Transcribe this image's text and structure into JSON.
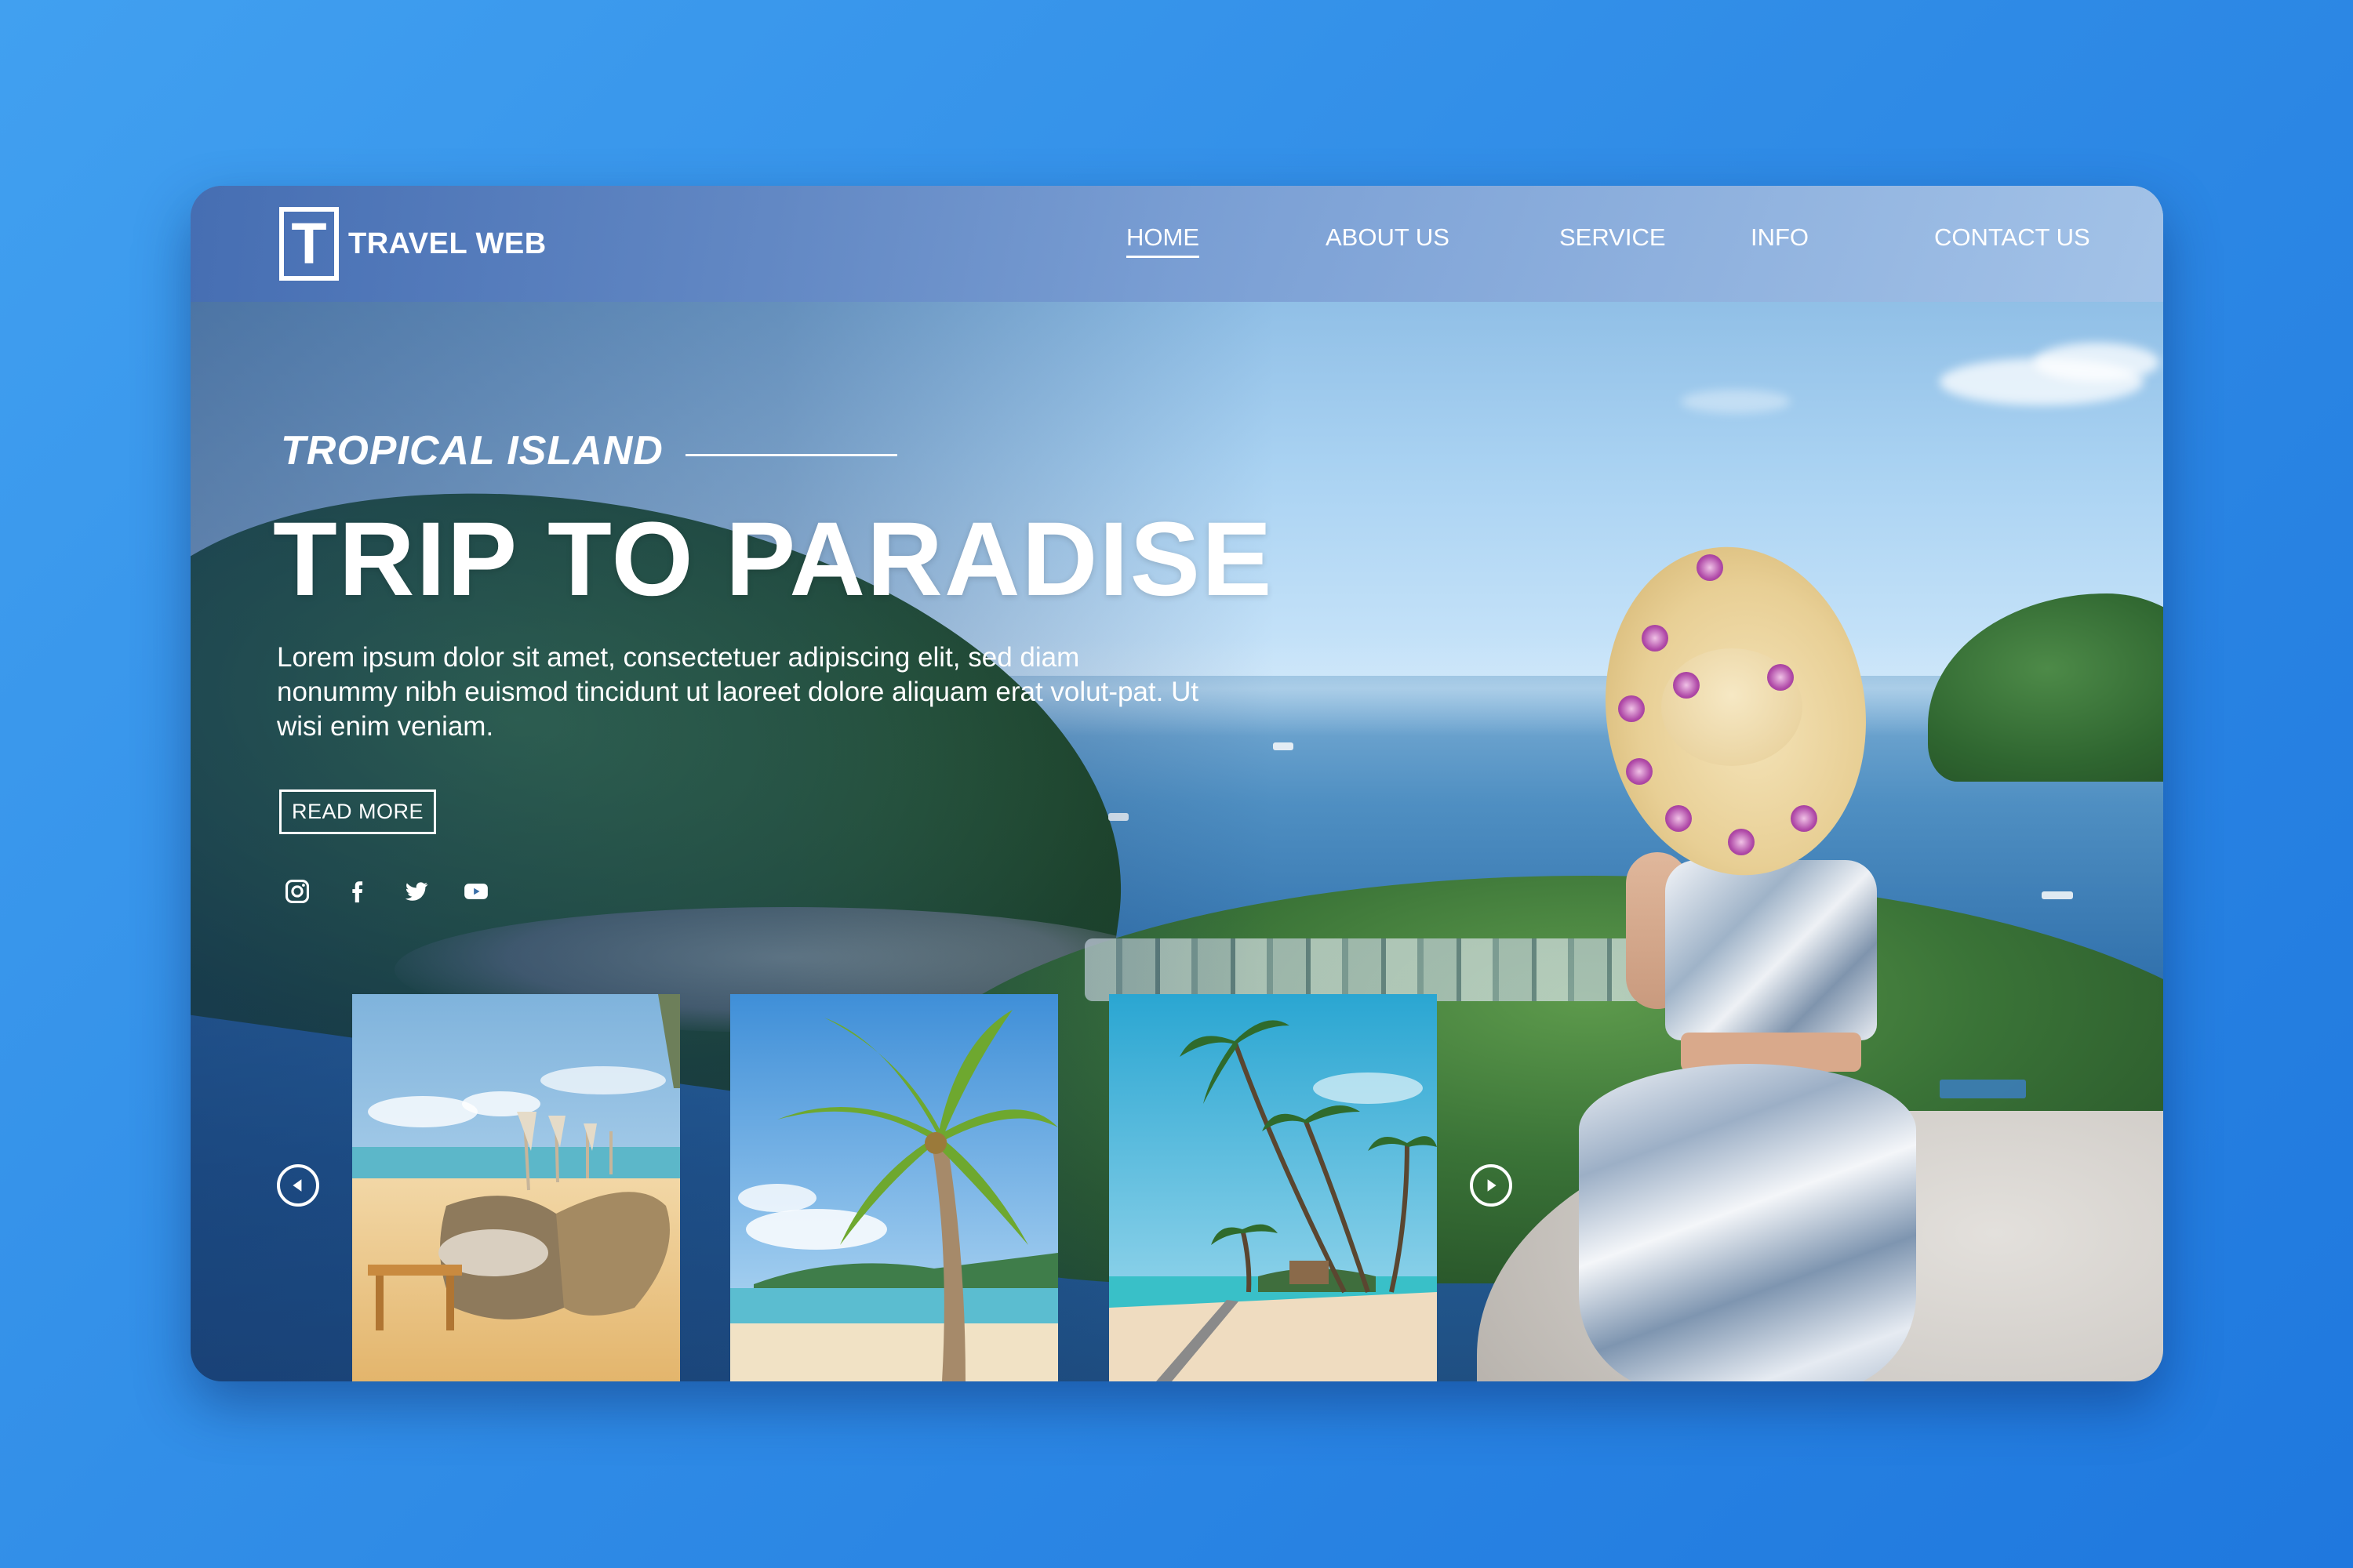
{
  "brand": {
    "logo_letter": "T",
    "name": "TRAVEL WEB"
  },
  "nav": {
    "items": [
      {
        "label": "HOME",
        "active": true
      },
      {
        "label": "ABOUT US",
        "active": false
      },
      {
        "label": "SERVICE",
        "active": false
      },
      {
        "label": "INFO",
        "active": false
      },
      {
        "label": "CONTACT US",
        "active": false
      }
    ]
  },
  "hero": {
    "eyebrow": "TROPICAL ISLAND",
    "headline": "TRIP TO PARADISE",
    "body": "Lorem ipsum dolor sit amet, consectetuer adipiscing elit, sed diam nonummy nibh euismod tincidunt ut laoreet dolore  aliquam erat volut-pat. Ut wisi enim veniam.",
    "cta": "READ MORE"
  },
  "socials": [
    "instagram-icon",
    "facebook-icon",
    "twitter-icon",
    "youtube-icon"
  ],
  "gallery": {
    "thumbnails": [
      "beach-lounge-chairs",
      "coconut-palm-tree",
      "palm-beach-shore"
    ],
    "prev_icon": "play-left-icon",
    "next_icon": "play-right-icon"
  },
  "colors": {
    "page_bg": "#2f8be6",
    "header_bg": "#6e96cf",
    "text": "#ffffff"
  }
}
